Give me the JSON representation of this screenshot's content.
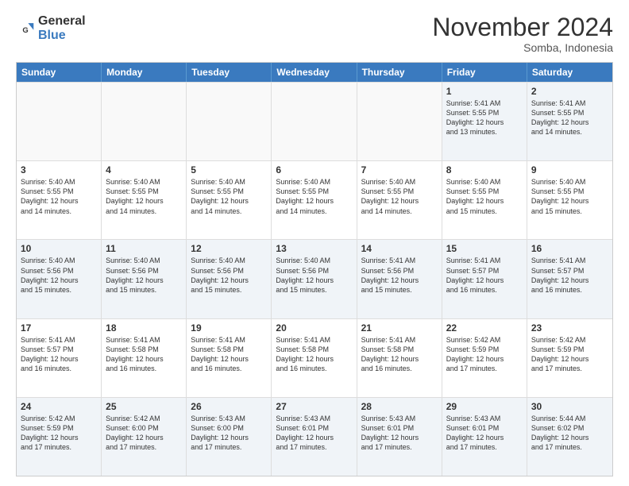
{
  "logo": {
    "line1": "General",
    "line2": "Blue"
  },
  "header": {
    "month": "November 2024",
    "location": "Somba, Indonesia"
  },
  "days": [
    "Sunday",
    "Monday",
    "Tuesday",
    "Wednesday",
    "Thursday",
    "Friday",
    "Saturday"
  ],
  "rows": [
    [
      {
        "day": "",
        "info": ""
      },
      {
        "day": "",
        "info": ""
      },
      {
        "day": "",
        "info": ""
      },
      {
        "day": "",
        "info": ""
      },
      {
        "day": "",
        "info": ""
      },
      {
        "day": "1",
        "info": "Sunrise: 5:41 AM\nSunset: 5:55 PM\nDaylight: 12 hours\nand 13 minutes."
      },
      {
        "day": "2",
        "info": "Sunrise: 5:41 AM\nSunset: 5:55 PM\nDaylight: 12 hours\nand 14 minutes."
      }
    ],
    [
      {
        "day": "3",
        "info": "Sunrise: 5:40 AM\nSunset: 5:55 PM\nDaylight: 12 hours\nand 14 minutes."
      },
      {
        "day": "4",
        "info": "Sunrise: 5:40 AM\nSunset: 5:55 PM\nDaylight: 12 hours\nand 14 minutes."
      },
      {
        "day": "5",
        "info": "Sunrise: 5:40 AM\nSunset: 5:55 PM\nDaylight: 12 hours\nand 14 minutes."
      },
      {
        "day": "6",
        "info": "Sunrise: 5:40 AM\nSunset: 5:55 PM\nDaylight: 12 hours\nand 14 minutes."
      },
      {
        "day": "7",
        "info": "Sunrise: 5:40 AM\nSunset: 5:55 PM\nDaylight: 12 hours\nand 14 minutes."
      },
      {
        "day": "8",
        "info": "Sunrise: 5:40 AM\nSunset: 5:55 PM\nDaylight: 12 hours\nand 15 minutes."
      },
      {
        "day": "9",
        "info": "Sunrise: 5:40 AM\nSunset: 5:55 PM\nDaylight: 12 hours\nand 15 minutes."
      }
    ],
    [
      {
        "day": "10",
        "info": "Sunrise: 5:40 AM\nSunset: 5:56 PM\nDaylight: 12 hours\nand 15 minutes."
      },
      {
        "day": "11",
        "info": "Sunrise: 5:40 AM\nSunset: 5:56 PM\nDaylight: 12 hours\nand 15 minutes."
      },
      {
        "day": "12",
        "info": "Sunrise: 5:40 AM\nSunset: 5:56 PM\nDaylight: 12 hours\nand 15 minutes."
      },
      {
        "day": "13",
        "info": "Sunrise: 5:40 AM\nSunset: 5:56 PM\nDaylight: 12 hours\nand 15 minutes."
      },
      {
        "day": "14",
        "info": "Sunrise: 5:41 AM\nSunset: 5:56 PM\nDaylight: 12 hours\nand 15 minutes."
      },
      {
        "day": "15",
        "info": "Sunrise: 5:41 AM\nSunset: 5:57 PM\nDaylight: 12 hours\nand 16 minutes."
      },
      {
        "day": "16",
        "info": "Sunrise: 5:41 AM\nSunset: 5:57 PM\nDaylight: 12 hours\nand 16 minutes."
      }
    ],
    [
      {
        "day": "17",
        "info": "Sunrise: 5:41 AM\nSunset: 5:57 PM\nDaylight: 12 hours\nand 16 minutes."
      },
      {
        "day": "18",
        "info": "Sunrise: 5:41 AM\nSunset: 5:58 PM\nDaylight: 12 hours\nand 16 minutes."
      },
      {
        "day": "19",
        "info": "Sunrise: 5:41 AM\nSunset: 5:58 PM\nDaylight: 12 hours\nand 16 minutes."
      },
      {
        "day": "20",
        "info": "Sunrise: 5:41 AM\nSunset: 5:58 PM\nDaylight: 12 hours\nand 16 minutes."
      },
      {
        "day": "21",
        "info": "Sunrise: 5:41 AM\nSunset: 5:58 PM\nDaylight: 12 hours\nand 16 minutes."
      },
      {
        "day": "22",
        "info": "Sunrise: 5:42 AM\nSunset: 5:59 PM\nDaylight: 12 hours\nand 17 minutes."
      },
      {
        "day": "23",
        "info": "Sunrise: 5:42 AM\nSunset: 5:59 PM\nDaylight: 12 hours\nand 17 minutes."
      }
    ],
    [
      {
        "day": "24",
        "info": "Sunrise: 5:42 AM\nSunset: 5:59 PM\nDaylight: 12 hours\nand 17 minutes."
      },
      {
        "day": "25",
        "info": "Sunrise: 5:42 AM\nSunset: 6:00 PM\nDaylight: 12 hours\nand 17 minutes."
      },
      {
        "day": "26",
        "info": "Sunrise: 5:43 AM\nSunset: 6:00 PM\nDaylight: 12 hours\nand 17 minutes."
      },
      {
        "day": "27",
        "info": "Sunrise: 5:43 AM\nSunset: 6:01 PM\nDaylight: 12 hours\nand 17 minutes."
      },
      {
        "day": "28",
        "info": "Sunrise: 5:43 AM\nSunset: 6:01 PM\nDaylight: 12 hours\nand 17 minutes."
      },
      {
        "day": "29",
        "info": "Sunrise: 5:43 AM\nSunset: 6:01 PM\nDaylight: 12 hours\nand 17 minutes."
      },
      {
        "day": "30",
        "info": "Sunrise: 5:44 AM\nSunset: 6:02 PM\nDaylight: 12 hours\nand 17 minutes."
      }
    ]
  ]
}
